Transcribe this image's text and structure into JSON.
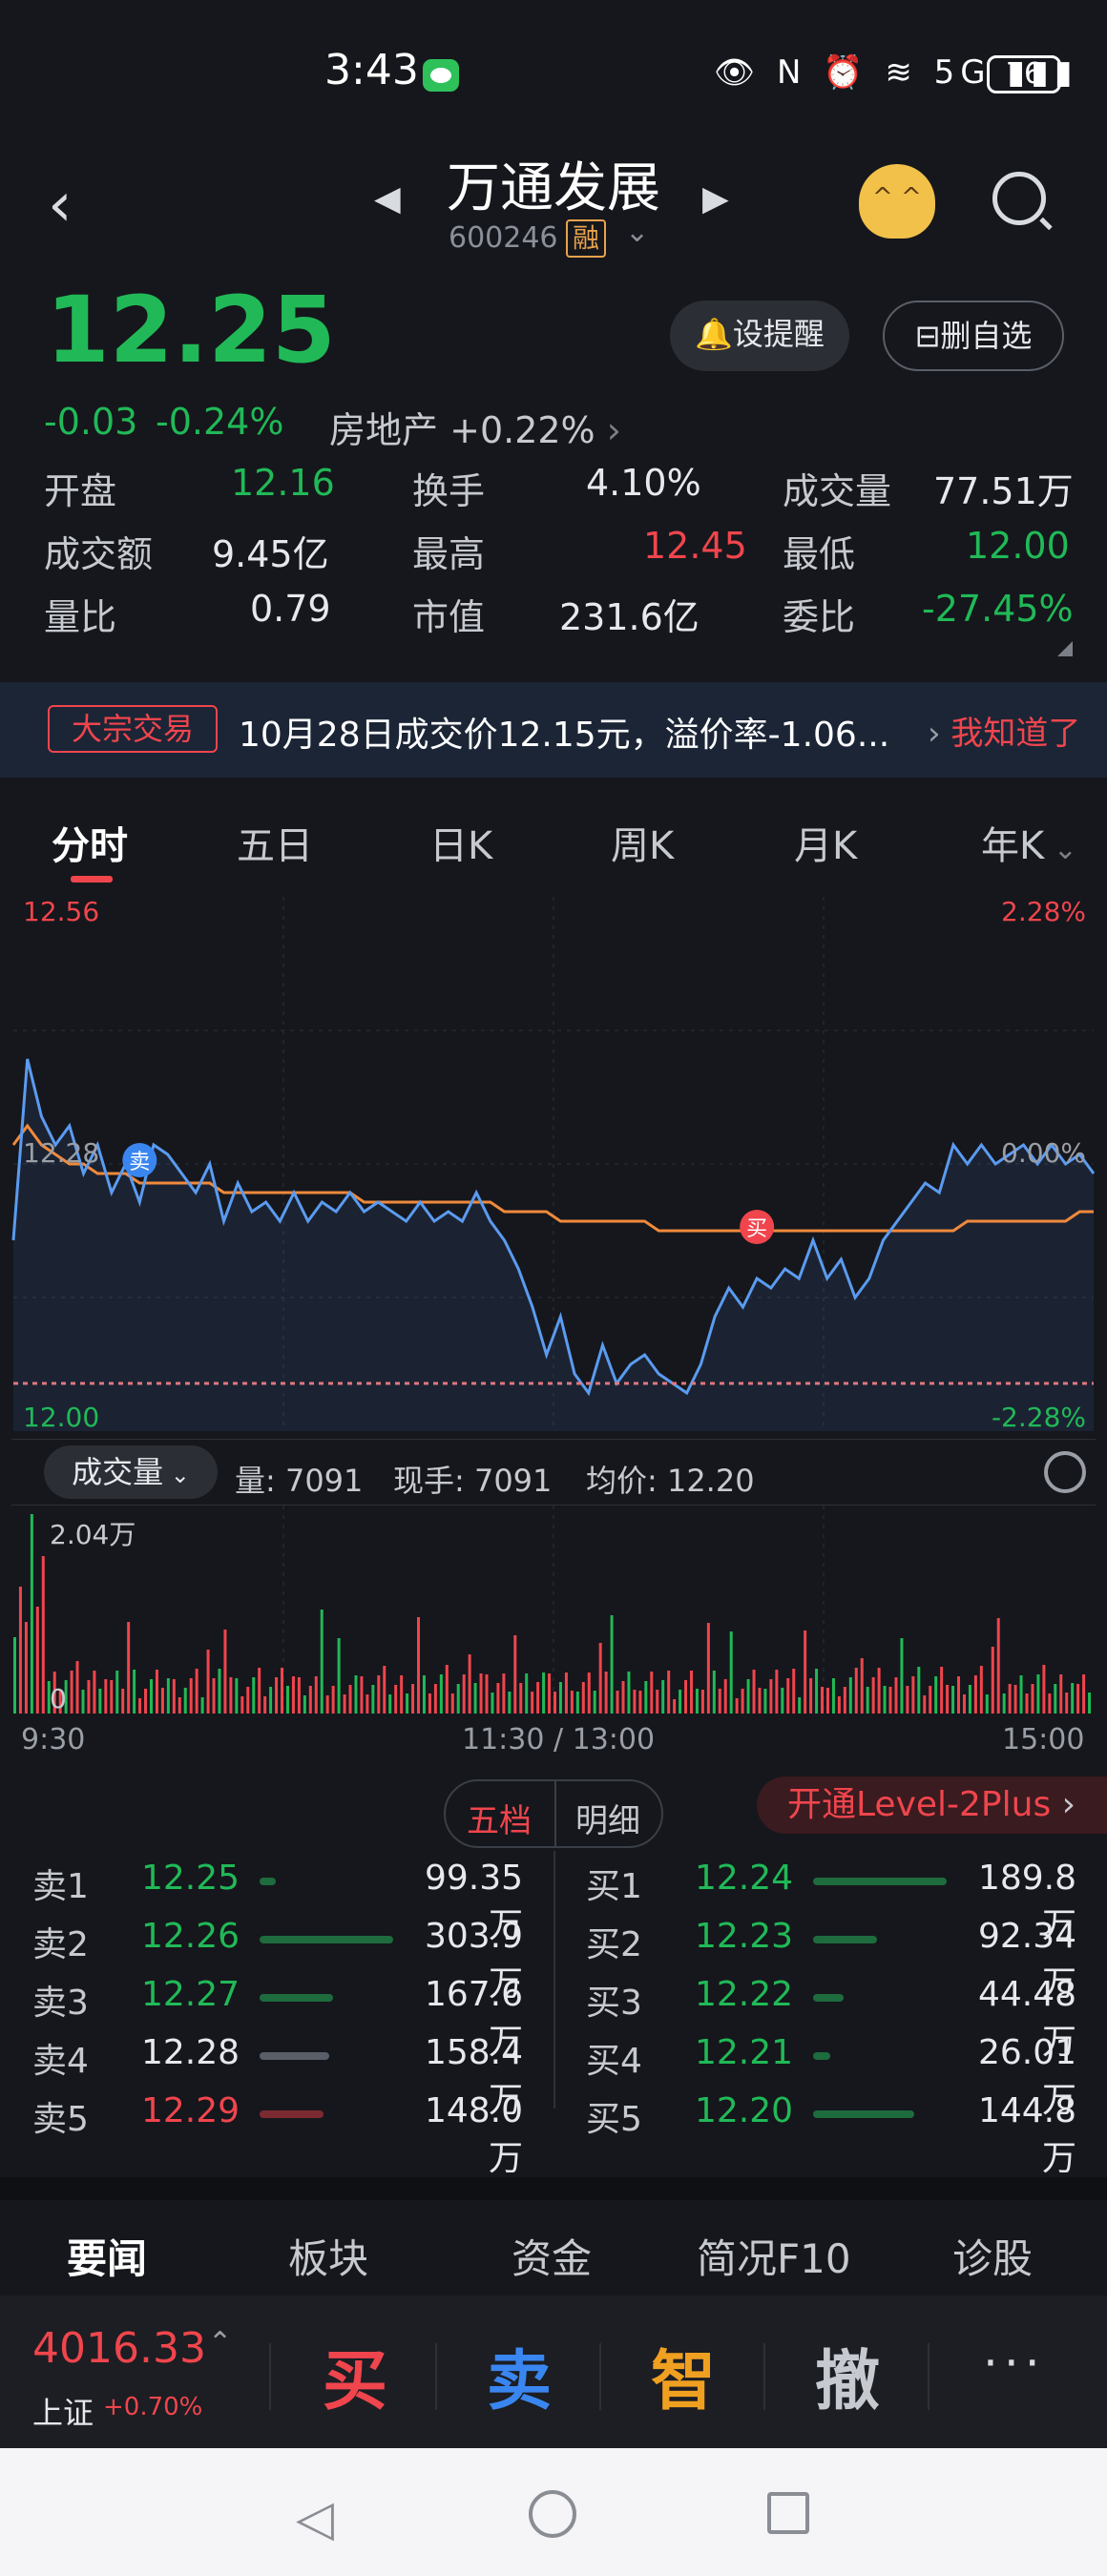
{
  "status_bar": {
    "time": "3:43",
    "battery": "76",
    "network_icons": "👁 N ⏰ ≋ 5G ▮▮▮"
  },
  "header": {
    "stock_name": "万通发展",
    "stock_code": "600246",
    "margin_badge": "融"
  },
  "quote": {
    "price": "12.25",
    "change": "-0.03",
    "change_pct": "-0.24%",
    "sector_name": "房地产",
    "sector_change": "+0.22%",
    "remind_label": "设提醒",
    "delete_label": "删自选"
  },
  "stats": [
    {
      "label": "开盘",
      "value": "12.16",
      "color": "green"
    },
    {
      "label": "换手",
      "value": "4.10%",
      "color": "white"
    },
    {
      "label": "成交量",
      "value": "77.51万",
      "color": "white"
    },
    {
      "label": "成交额",
      "value": "9.45亿",
      "color": "white"
    },
    {
      "label": "最高",
      "value": "12.45",
      "color": "red"
    },
    {
      "label": "最低",
      "value": "12.00",
      "color": "green"
    },
    {
      "label": "量比",
      "value": "0.79",
      "color": "white"
    },
    {
      "label": "市值",
      "value": "231.6亿",
      "color": "white"
    },
    {
      "label": "委比",
      "value": "-27.45%",
      "color": "green"
    }
  ],
  "banner": {
    "tag": "大宗交易",
    "message": "10月28日成交价12.15元，溢价率-1.06...",
    "action": "我知道了"
  },
  "chart_tabs": [
    "分时",
    "五日",
    "日K",
    "周K",
    "月K",
    "年K"
  ],
  "chart_data": {
    "type": "line",
    "y_top_label": "12.56",
    "y_mid_label": "12.28",
    "y_bottom_label": "12.00",
    "pct_top_label": "2.28%",
    "pct_mid_label": "0.00%",
    "pct_bottom_label": "-2.28%",
    "ylim": [
      12.0,
      12.56
    ],
    "prev_close": 12.28,
    "x": [
      "9:30",
      "11:30 / 13:00",
      "15:00"
    ],
    "series": [
      {
        "values": [
          12.2,
          12.39,
          12.33,
          12.3,
          12.32,
          12.27,
          12.3,
          12.25,
          12.28,
          12.24,
          12.3,
          12.29,
          12.27,
          12.25,
          12.28,
          12.22,
          12.26,
          12.23,
          12.24,
          12.22,
          12.25,
          12.22,
          12.24,
          12.23,
          12.25,
          12.23,
          12.24,
          12.23,
          12.22,
          12.24,
          12.22,
          12.23,
          12.22,
          12.25,
          12.22,
          12.2,
          12.17,
          12.13,
          12.08,
          12.12,
          12.06,
          12.04,
          12.09,
          12.05,
          12.07,
          12.08,
          12.06,
          12.05,
          12.04,
          12.07,
          12.12,
          12.15,
          12.13,
          12.16,
          12.15,
          12.17,
          12.16,
          12.2,
          12.16,
          12.18,
          12.14,
          12.16,
          12.2,
          12.22,
          12.24,
          12.26,
          12.25,
          12.3,
          12.28,
          12.3,
          12.28,
          12.29,
          12.3,
          12.28,
          12.3,
          12.28,
          12.29,
          12.27
        ]
      },
      {
        "values": [
          12.3,
          12.32,
          12.3,
          12.29,
          12.28,
          12.28,
          12.27,
          12.27,
          12.27,
          12.26,
          12.26,
          12.26,
          12.26,
          12.26,
          12.26,
          12.25,
          12.25,
          12.25,
          12.25,
          12.25,
          12.25,
          12.25,
          12.25,
          12.25,
          12.25,
          12.24,
          12.24,
          12.24,
          12.24,
          12.24,
          12.24,
          12.24,
          12.24,
          12.24,
          12.24,
          12.23,
          12.23,
          12.23,
          12.23,
          12.22,
          12.22,
          12.22,
          12.22,
          12.22,
          12.22,
          12.22,
          12.21,
          12.21,
          12.21,
          12.21,
          12.21,
          12.21,
          12.21,
          12.21,
          12.21,
          12.21,
          12.21,
          12.21,
          12.21,
          12.21,
          12.21,
          12.21,
          12.21,
          12.21,
          12.21,
          12.21,
          12.21,
          12.21,
          12.22,
          12.22,
          12.22,
          12.22,
          12.22,
          12.22,
          12.22,
          12.22,
          12.23,
          12.23
        ]
      }
    ],
    "markers": [
      {
        "label": "卖",
        "index": 9,
        "value": 12.28
      },
      {
        "label": "买",
        "index": 53,
        "value": 12.21
      }
    ]
  },
  "volume_panel": {
    "selector": "成交量",
    "volume": "量: 7091",
    "current": "现手: 7091",
    "avg": "均价: 12.20",
    "max_label": "2.04万",
    "zero_label": "0"
  },
  "time_axis": {
    "start": "9:30",
    "mid": "11:30 / 13:00",
    "end": "15:00"
  },
  "order_book": {
    "tab_five": "五档",
    "tab_detail": "明细",
    "level2": "开通Level-2Plus",
    "asks": [
      {
        "label": "卖1",
        "price": "12.25",
        "volume": "99.35万",
        "depth": 0.12,
        "color": "green"
      },
      {
        "label": "卖2",
        "price": "12.26",
        "volume": "303.9万",
        "depth": 1.0,
        "color": "green"
      },
      {
        "label": "卖3",
        "price": "12.27",
        "volume": "167.6万",
        "depth": 0.55,
        "color": "green"
      },
      {
        "label": "卖4",
        "price": "12.28",
        "volume": "158.4万",
        "depth": 0.52,
        "color": "white"
      },
      {
        "label": "卖5",
        "price": "12.29",
        "volume": "148.0万",
        "depth": 0.48,
        "color": "red"
      }
    ],
    "bids": [
      {
        "label": "买1",
        "price": "12.24",
        "volume": "189.8万",
        "depth": 1.0,
        "color": "green"
      },
      {
        "label": "买2",
        "price": "12.23",
        "volume": "92.34万",
        "depth": 0.48,
        "color": "green"
      },
      {
        "label": "买3",
        "price": "12.22",
        "volume": "44.48万",
        "depth": 0.23,
        "color": "green"
      },
      {
        "label": "买4",
        "price": "12.21",
        "volume": "26.01万",
        "depth": 0.13,
        "color": "green"
      },
      {
        "label": "买5",
        "price": "12.20",
        "volume": "144.8万",
        "depth": 0.76,
        "color": "green"
      }
    ]
  },
  "news_tabs": [
    "要闻",
    "板块",
    "资金",
    "简况F10",
    "诊股"
  ],
  "bottom": {
    "index_value": "4016.33",
    "index_name": "上证",
    "index_change": "+0.70%",
    "buy": "买",
    "sell": "卖",
    "smart": "智",
    "cancel": "撤",
    "more": "···"
  },
  "colors": {
    "up": "#f0454d",
    "down": "#21b957",
    "price_line": "#5b9bf0",
    "avg_line": "#f08a3c"
  },
  "icons": [
    "back-chevron-icon",
    "search-icon",
    "bell-icon",
    "mascot-icon",
    "gear-icon"
  ]
}
